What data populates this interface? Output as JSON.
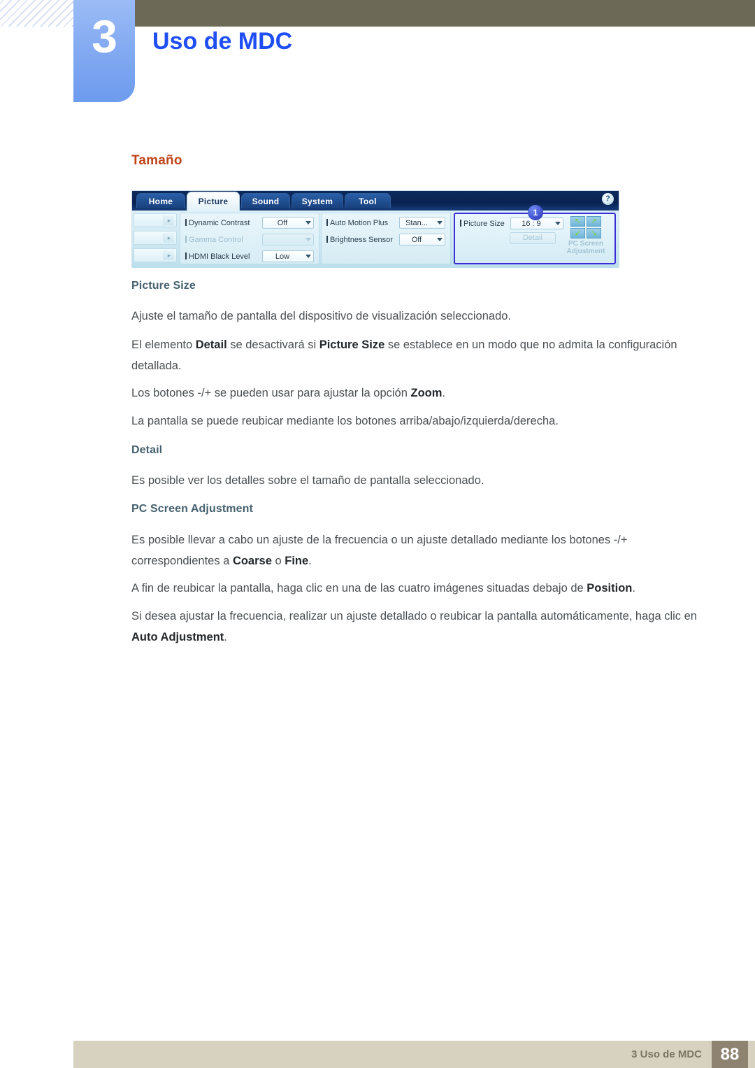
{
  "header": {
    "chapter_number": "3",
    "chapter_title": "Uso de MDC"
  },
  "section": {
    "heading": "Tamaño",
    "heading_color": "#c0441a"
  },
  "mdc_screenshot": {
    "help_icon_label": "?",
    "tabs": [
      {
        "label": "Home",
        "active": false
      },
      {
        "label": "Picture",
        "active": true
      },
      {
        "label": "Sound",
        "active": false
      },
      {
        "label": "System",
        "active": false
      },
      {
        "label": "Tool",
        "active": false
      }
    ],
    "group_left": {
      "rows": [
        {
          "label": "Dynamic Contrast",
          "value": "Off",
          "disabled": false
        },
        {
          "label": "Gamma Control",
          "value": "",
          "disabled": true
        },
        {
          "label": "HDMI Black Level",
          "value": "Low",
          "disabled": false
        }
      ]
    },
    "group_middle": {
      "rows": [
        {
          "label": "Auto Motion Plus",
          "value": "Stan...",
          "disabled": false
        },
        {
          "label": "Brightness Sensor",
          "value": "Off",
          "disabled": false
        }
      ]
    },
    "group_right": {
      "highlight_color": "#3a2fd6",
      "badge": "1",
      "picture_size_label": "Picture Size",
      "picture_size_value": "16 : 9",
      "detail_button": "Detail",
      "pc_screen_adjustment_label": "PC Screen Adjustment",
      "arrow_glyphs": [
        "↖",
        "↗",
        "↙",
        "↘"
      ]
    }
  },
  "body": {
    "h_picture_size": "Picture Size",
    "p1": "Ajuste el tamaño de pantalla del dispositivo de visualización seleccionado.",
    "p2_a": "El elemento ",
    "p2_b": "Detail",
    "p2_c": " se desactivará si ",
    "p2_d": "Picture Size",
    "p2_e": " se establece en un modo que no admita la configuración detallada.",
    "p3_a": "Los botones -/+ se pueden usar para ajustar la opción ",
    "p3_b": "Zoom",
    "p3_c": ".",
    "p4": "La pantalla se puede reubicar mediante los botones arriba/abajo/izquierda/derecha.",
    "h_detail": "Detail",
    "p5": "Es posible ver los detalles sobre el tamaño de pantalla seleccionado.",
    "h_pcsa": "PC Screen Adjustment",
    "p6_a": "Es posible llevar a cabo un ajuste de la frecuencia o un ajuste detallado mediante los botones -/+ correspondientes a ",
    "p6_b": "Coarse",
    "p6_c": " o ",
    "p6_d": "Fine",
    "p6_e": ".",
    "p7_a": "A fin de reubicar la pantalla, haga clic en una de las cuatro imágenes situadas debajo de ",
    "p7_b": "Position",
    "p7_c": ".",
    "p8_a": "Si desea ajustar la frecuencia, realizar un ajuste detallado o reubicar la pantalla automáticamente, haga clic en ",
    "p8_b": "Auto Adjustment",
    "p8_c": "."
  },
  "footer": {
    "text": "3 Uso de MDC",
    "page_number": "88"
  }
}
